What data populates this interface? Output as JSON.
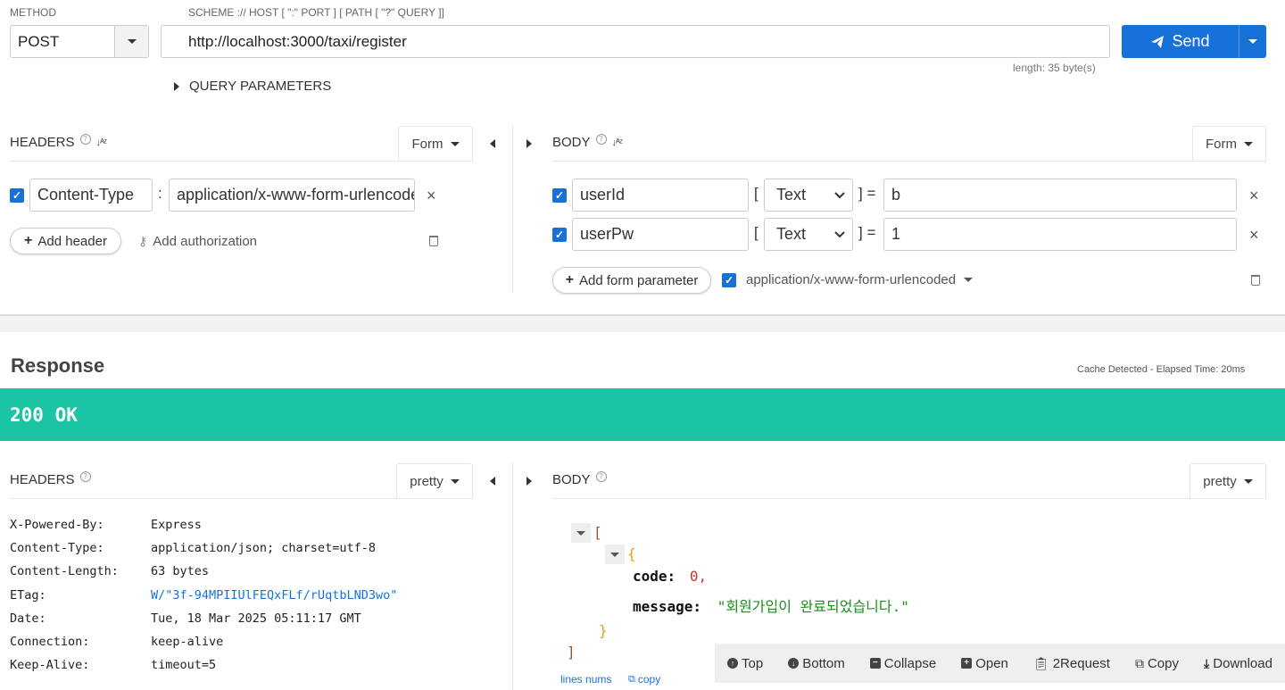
{
  "request": {
    "method_label": "METHOD",
    "method_value": "POST",
    "url_hint": "SCHEME :// HOST [ \":\" PORT ] [ PATH [ \"?\" QUERY ]]",
    "url_value": "http://localhost:3000/taxi/register",
    "url_length": "length: 35 byte(s)",
    "send_label": "Send",
    "query_params_label": "QUERY PARAMETERS"
  },
  "req_headers": {
    "title": "HEADERS",
    "format": "Form",
    "rows": [
      {
        "name": "Content-Type",
        "sep": ":",
        "value": "application/x-www-form-urlencoded"
      }
    ],
    "add_header": "Add header",
    "add_authorization": "Add authorization"
  },
  "req_body": {
    "title": "BODY",
    "format": "Form",
    "rows": [
      {
        "name": "userId",
        "type": "Text",
        "value": "b"
      },
      {
        "name": "userPw",
        "type": "Text",
        "value": "1"
      }
    ],
    "bracket_open": "[",
    "bracket_close": "] =",
    "add_param": "Add form parameter",
    "content_type": "application/x-www-form-urlencoded"
  },
  "response": {
    "title": "Response",
    "cache_info": "Cache Detected - Elapsed Time: 20ms",
    "status": "200 OK",
    "status_color": "#1ac4a4",
    "headers_title": "HEADERS",
    "headers_format": "pretty",
    "headers": [
      {
        "name": "X-Powered-By:",
        "value": "Express",
        "link": false
      },
      {
        "name": "Content-Type:",
        "value": "application/json; charset=utf-8",
        "link": false
      },
      {
        "name": "Content-Length:",
        "value": "63 bytes",
        "link": false
      },
      {
        "name": "ETag:",
        "value": "W/\"3f-94MPIIUlFEQxFLf/rUqtbLND3wo\"",
        "link": true
      },
      {
        "name": "Date:",
        "value": "Tue, 18 Mar 2025 05:11:17 GMT",
        "link": false
      },
      {
        "name": "Connection:",
        "value": "keep-alive",
        "link": false
      },
      {
        "name": "Keep-Alive:",
        "value": "timeout=5",
        "link": false
      }
    ],
    "body_title": "BODY",
    "body_format": "pretty",
    "json": {
      "open_array": "[",
      "open_obj": "{",
      "code_key": "code:",
      "code_val": "0,",
      "msg_key": "message:",
      "msg_val": "\"회원가입이 완료되었습니다.\"",
      "close_obj": "}",
      "close_array": "]"
    },
    "lines_nums": "lines nums",
    "copy_link": "copy"
  },
  "toolbar": {
    "top": "Top",
    "bottom": "Bottom",
    "collapse": "Collapse",
    "open": "Open",
    "to_request": "2Request",
    "copy": "Copy",
    "download": "Download"
  }
}
